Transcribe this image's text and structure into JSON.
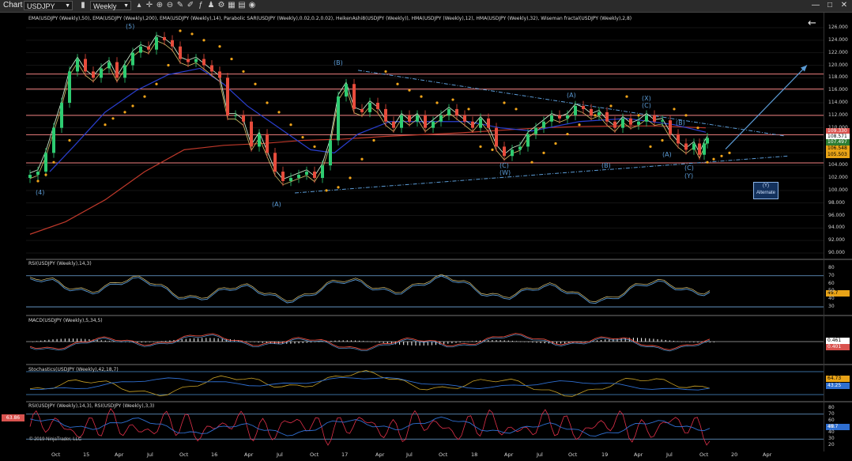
{
  "toolbar": {
    "title": "Chart",
    "instrument": "USDJPY",
    "period": "Weekly",
    "minimize": "—",
    "maximize": "□",
    "close": "✕"
  },
  "main_panel": {
    "title": "EMA(USDJPY (Weekly),50), EMA(USDJPY (Weekly),200), EMA(USDJPY (Weekly),14), Parabolic SAR(USDJPY (Weekly),0.02,0.2,0.02), HeikenAshi8(USDJPY (Weekly)), HMA(USDJPY (Weekly),12), HMA(USDJPY (Weekly),32), Wiseman fractal(USDJPY (Weekly),2,8)",
    "y_ticks": [
      "126.000",
      "124.000",
      "122.000",
      "120.000",
      "118.000",
      "116.000",
      "114.000",
      "112.000",
      "110.000",
      "108.000",
      "106.000",
      "104.000",
      "102.000",
      "100.000",
      "98.000",
      "96.000",
      "94.000",
      "92.000",
      "90.000"
    ],
    "price_labels": [
      {
        "text": "109.330",
        "bg": "#d9534f",
        "fg": "#ffffff"
      },
      {
        "text": "108.571",
        "bg": "#ffffff",
        "fg": "#000000"
      },
      {
        "text": "107.497",
        "bg": "#2e7d32",
        "fg": "#ffffff"
      },
      {
        "text": "106.548",
        "bg": "#e8a317",
        "fg": "#000000"
      },
      {
        "text": "105.503",
        "bg": "#e8a317",
        "fg": "#000000"
      }
    ],
    "waves": [
      "(4)",
      "(5)",
      "(A)",
      "(B)",
      "(C)",
      "(W)",
      "(A)",
      "(B)",
      "(X)",
      "(C)",
      "(A)",
      "(B)",
      "(C)",
      "(Y)"
    ],
    "alternate_box": {
      "line1": "(Y)",
      "line2": "Alternate"
    },
    "back_arrow": "←"
  },
  "rsi_panel": {
    "title": "RSI(USDJPY (Weekly),14,3)",
    "y_ticks": [
      "80",
      "70",
      "60",
      "50",
      "40",
      "30"
    ],
    "value": "49.7"
  },
  "macd_panel": {
    "title": "MACD(USDJPY (Weekly),5,34,5)",
    "value1": "0.461",
    "value2": "0.401"
  },
  "stoch_panel": {
    "title": "Stochastics(USDJPY (Weekly),42,18,7)",
    "value1": "64.73",
    "value2": "43.25"
  },
  "rsi2_panel": {
    "title": "RSI(USDJPY (Weekly),14,3), RSI(USDJPY (Weekly),3,3)",
    "y_ticks": [
      "80",
      "70",
      "60",
      "50",
      "40",
      "30",
      "20"
    ],
    "left_value": "63.86",
    "value": "49.7"
  },
  "x_axis": [
    "Oct",
    "15",
    "Apr",
    "Jul",
    "Oct",
    "16",
    "Apr",
    "Jul",
    "Oct",
    "17",
    "Apr",
    "Jul",
    "Oct",
    "18",
    "Apr",
    "Jul",
    "Oct",
    "19",
    "Apr",
    "Jul",
    "Oct",
    "20",
    "Apr"
  ],
  "copyright": "© 2019 NinjaTrader, LLC",
  "colors": {
    "ema200": "#c0392b",
    "ema50": "#2a3fcf",
    "psar": "#f2a51a",
    "resistance": "#f08080",
    "trendline": "#5b9bd5",
    "candle_up": "#2ecc71",
    "candle_down": "#e74c3c"
  }
}
